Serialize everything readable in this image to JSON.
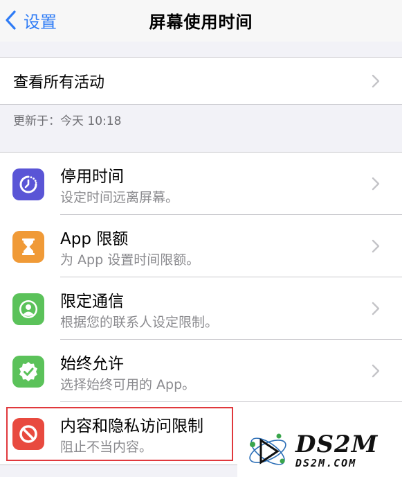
{
  "nav": {
    "back_label": "设置",
    "title": "屏幕使用时间"
  },
  "activity": {
    "label": "查看所有活动",
    "updated": "更新于：今天 10:18"
  },
  "items": [
    {
      "title": "停用时间",
      "subtitle": "设定时间远离屏幕。",
      "icon": "downtime-icon",
      "color": "#5a55d6"
    },
    {
      "title": "App 限额",
      "subtitle": "为 App 设置时间限额。",
      "icon": "hourglass-icon",
      "color": "#f09a37"
    },
    {
      "title": "限定通信",
      "subtitle": "根据您的联系人设定限制。",
      "icon": "contact-icon",
      "color": "#5bc25a"
    },
    {
      "title": "始终允许",
      "subtitle": "选择始终可用的 App。",
      "icon": "checkmark-badge-icon",
      "color": "#5bc25a"
    },
    {
      "title": "内容和隐私访问限制",
      "subtitle": "阻止不当内容。",
      "icon": "prohibited-icon",
      "color": "#e84a3f"
    }
  ],
  "watermark": {
    "brand": "DS2M",
    "domain": "DS2M.COM"
  },
  "colors": {
    "accent": "#2f7cf6",
    "highlight_box": "#e0383c"
  }
}
